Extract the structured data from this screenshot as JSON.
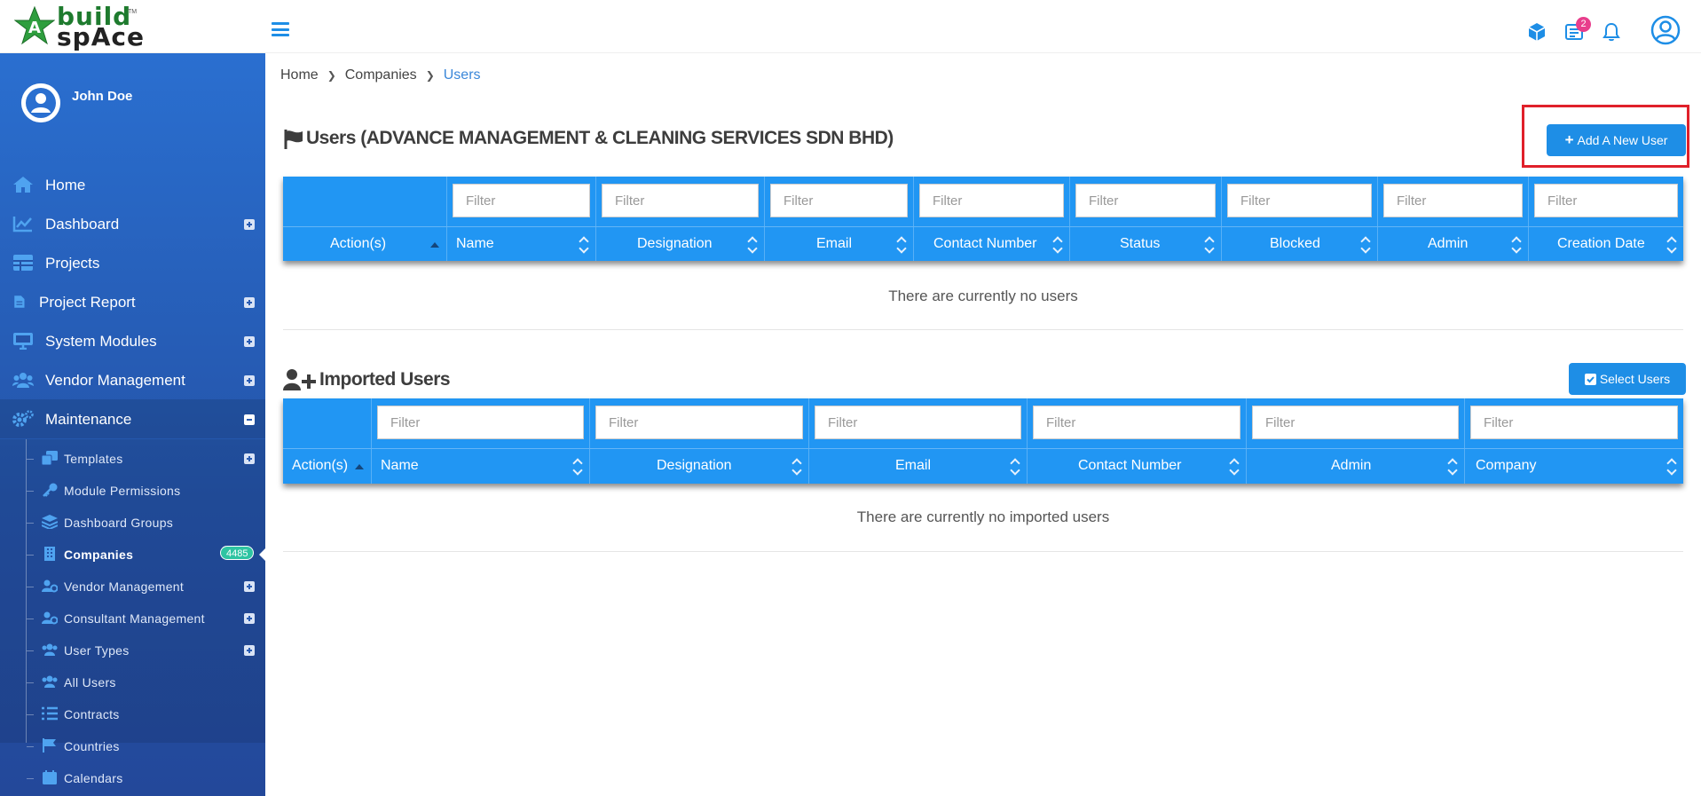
{
  "brand": {
    "line1": "build",
    "line2": "spAce",
    "tm": "TM"
  },
  "header": {
    "notification_count": "2"
  },
  "sidebar": {
    "user_name": "John Doe",
    "items": [
      {
        "label": "Home"
      },
      {
        "label": "Dashboard"
      },
      {
        "label": "Projects"
      },
      {
        "label": "Project Report"
      },
      {
        "label": "System Modules"
      },
      {
        "label": "Vendor Management"
      },
      {
        "label": "Maintenance"
      }
    ],
    "sub_items": [
      {
        "label": "Templates"
      },
      {
        "label": "Module Permissions"
      },
      {
        "label": "Dashboard Groups"
      },
      {
        "label": "Companies",
        "badge": "4485"
      },
      {
        "label": "Vendor Management"
      },
      {
        "label": "Consultant Management"
      },
      {
        "label": "User Types"
      },
      {
        "label": "All Users"
      },
      {
        "label": "Contracts"
      },
      {
        "label": "Countries"
      },
      {
        "label": "Calendars"
      }
    ]
  },
  "breadcrumb": [
    "Home",
    "Companies",
    "Users"
  ],
  "users_section": {
    "title": "Users (ADVANCE MANAGEMENT & CLEANING SERVICES SDN BHD)",
    "add_button": "Add A New User",
    "filter_placeholder": "Filter",
    "columns": [
      "Action(s)",
      "Name",
      "Designation",
      "Email",
      "Contact Number",
      "Status",
      "Blocked",
      "Admin",
      "Creation Date"
    ],
    "empty_message": "There are currently no users"
  },
  "imported_section": {
    "title": "Imported Users",
    "select_button": "Select Users",
    "filter_placeholder": "Filter",
    "columns": [
      "Action(s)",
      "Name",
      "Designation",
      "Email",
      "Contact Number",
      "Admin",
      "Company"
    ],
    "empty_message": "There are currently no imported users"
  },
  "colors": {
    "accent": "#2196f3",
    "button": "#1e8ee6",
    "highlight": "#e0202a",
    "sidebar": "#2a6fd0"
  }
}
